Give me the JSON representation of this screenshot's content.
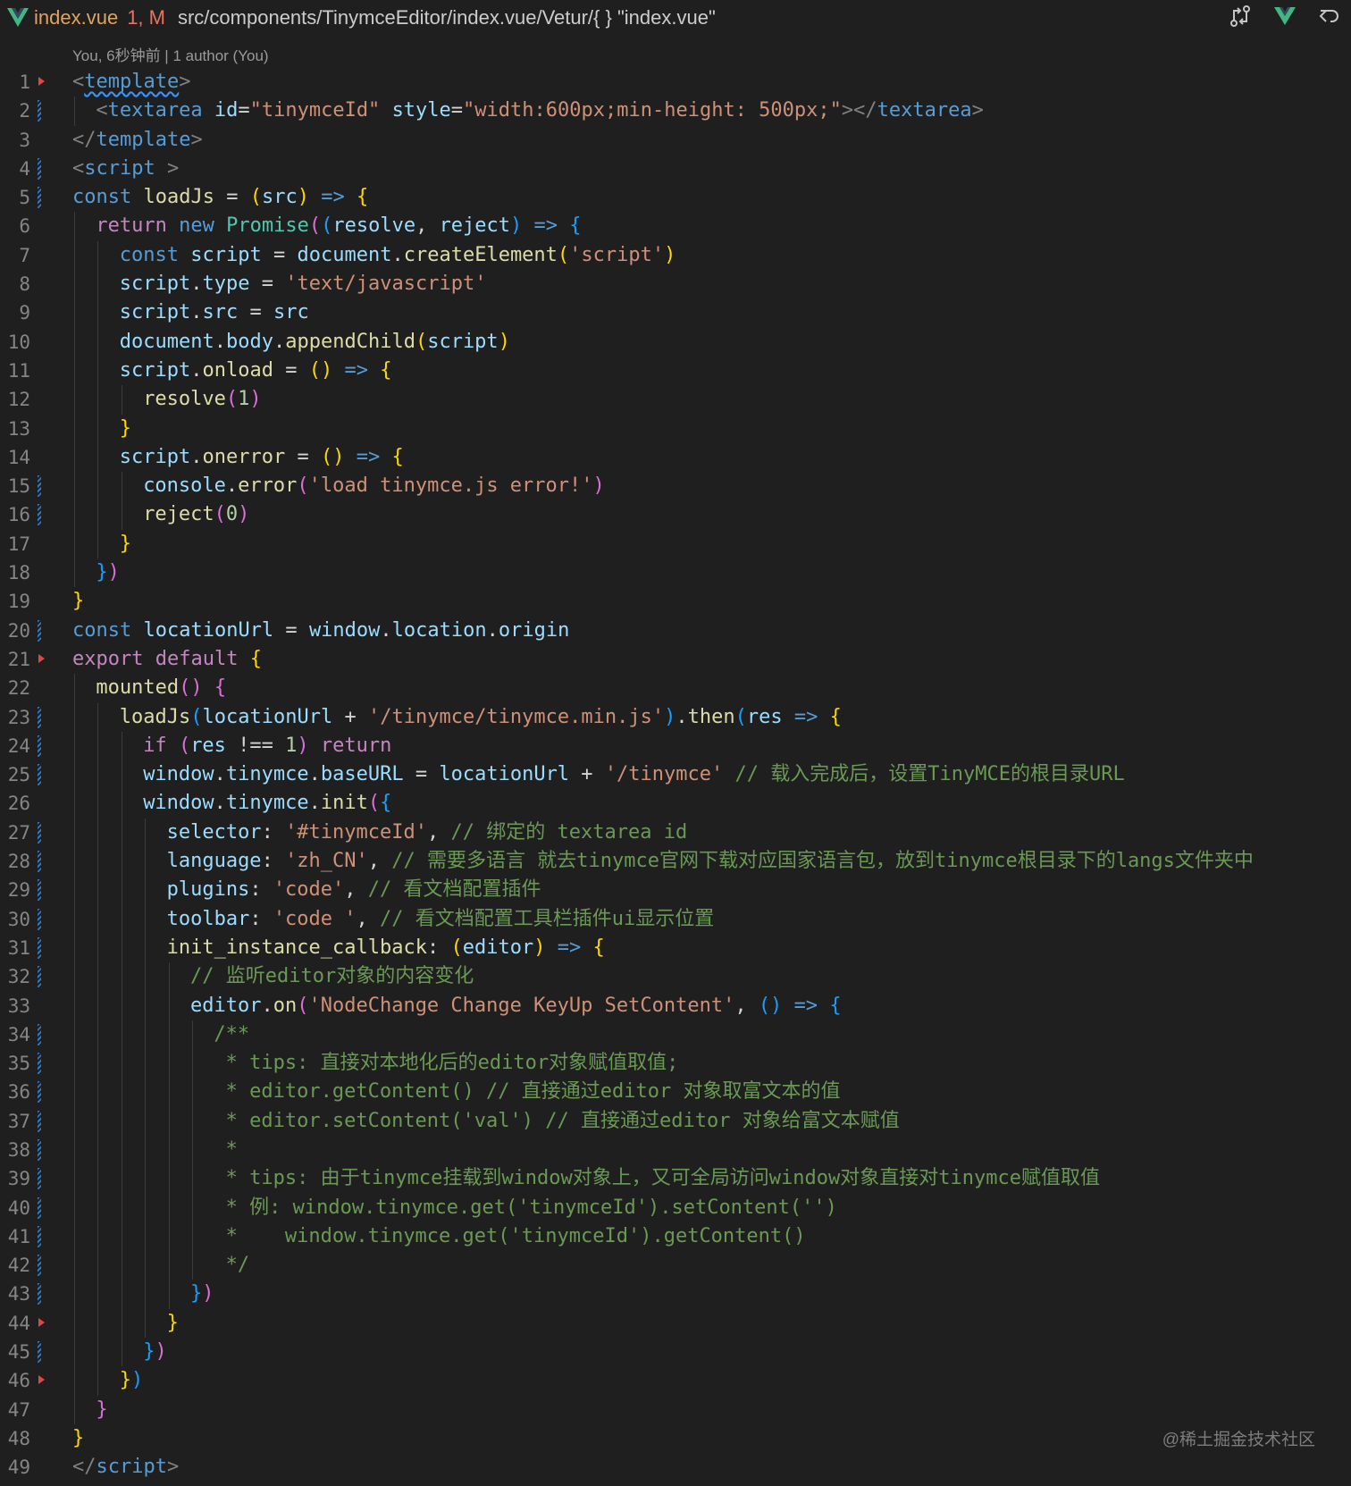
{
  "tab": {
    "name": "index.vue",
    "status": "1, M",
    "breadcrumb": "src/components/TinymceEditor/index.vue/Vetur/{ } \"index.vue\""
  },
  "blame": "You, 6秒钟前 | 1 author (You)",
  "lines": [
    {
      "n": "1",
      "gutter": "mark",
      "indent": 0,
      "tokens": [
        [
          "t-punc",
          "<"
        ],
        [
          "t-tag squiggle",
          "template"
        ],
        [
          "t-punc",
          ">"
        ]
      ]
    },
    {
      "n": "2",
      "gutter": "mod",
      "indent": 1,
      "tokens": [
        [
          "t-punc",
          "<"
        ],
        [
          "t-tag",
          "textarea"
        ],
        [
          "t-plain",
          " "
        ],
        [
          "t-attr",
          "id"
        ],
        [
          "t-plain",
          "="
        ],
        [
          "t-str",
          "\"tinymceId\""
        ],
        [
          "t-plain",
          " "
        ],
        [
          "t-attr",
          "style"
        ],
        [
          "t-plain",
          "="
        ],
        [
          "t-str",
          "\"width:600px;min-height: 500px;\""
        ],
        [
          "t-punc",
          "></"
        ],
        [
          "t-tag",
          "textarea"
        ],
        [
          "t-punc",
          ">"
        ]
      ]
    },
    {
      "n": "3",
      "gutter": "",
      "indent": 0,
      "tokens": [
        [
          "t-punc",
          "</"
        ],
        [
          "t-tag",
          "template"
        ],
        [
          "t-punc",
          ">"
        ]
      ]
    },
    {
      "n": "4",
      "gutter": "mod",
      "indent": 0,
      "tokens": [
        [
          "t-punc",
          "<"
        ],
        [
          "t-tag",
          "script"
        ],
        [
          "t-plain",
          " "
        ],
        [
          "t-punc",
          ">"
        ]
      ]
    },
    {
      "n": "5",
      "gutter": "mod",
      "indent": 0,
      "tokens": [
        [
          "t-kw",
          "const"
        ],
        [
          "t-plain",
          " "
        ],
        [
          "t-fn",
          "loadJs"
        ],
        [
          "t-plain",
          " = "
        ],
        [
          "t-b1",
          "("
        ],
        [
          "t-var",
          "src"
        ],
        [
          "t-b1",
          ")"
        ],
        [
          "t-plain",
          " "
        ],
        [
          "t-kw",
          "=>"
        ],
        [
          "t-plain",
          " "
        ],
        [
          "t-b1",
          "{"
        ]
      ]
    },
    {
      "n": "6",
      "gutter": "",
      "indent": 1,
      "tokens": [
        [
          "t-ctrl",
          "return"
        ],
        [
          "t-plain",
          " "
        ],
        [
          "t-kw",
          "new"
        ],
        [
          "t-plain",
          " "
        ],
        [
          "t-cls",
          "Promise"
        ],
        [
          "t-b2",
          "("
        ],
        [
          "t-b3",
          "("
        ],
        [
          "t-var",
          "resolve"
        ],
        [
          "t-plain",
          ", "
        ],
        [
          "t-var",
          "reject"
        ],
        [
          "t-b3",
          ")"
        ],
        [
          "t-plain",
          " "
        ],
        [
          "t-kw",
          "=>"
        ],
        [
          "t-plain",
          " "
        ],
        [
          "t-b3",
          "{"
        ]
      ]
    },
    {
      "n": "7",
      "gutter": "",
      "indent": 2,
      "tokens": [
        [
          "t-kw",
          "const"
        ],
        [
          "t-plain",
          " "
        ],
        [
          "t-var",
          "script"
        ],
        [
          "t-plain",
          " = "
        ],
        [
          "t-var",
          "document"
        ],
        [
          "t-plain",
          "."
        ],
        [
          "t-fn",
          "createElement"
        ],
        [
          "t-b1",
          "("
        ],
        [
          "t-str",
          "'script'"
        ],
        [
          "t-b1",
          ")"
        ]
      ]
    },
    {
      "n": "8",
      "gutter": "",
      "indent": 2,
      "tokens": [
        [
          "t-var",
          "script"
        ],
        [
          "t-plain",
          "."
        ],
        [
          "t-var",
          "type"
        ],
        [
          "t-plain",
          " = "
        ],
        [
          "t-str",
          "'text/javascript'"
        ]
      ]
    },
    {
      "n": "9",
      "gutter": "",
      "indent": 2,
      "tokens": [
        [
          "t-var",
          "script"
        ],
        [
          "t-plain",
          "."
        ],
        [
          "t-var",
          "src"
        ],
        [
          "t-plain",
          " = "
        ],
        [
          "t-var",
          "src"
        ]
      ]
    },
    {
      "n": "10",
      "gutter": "",
      "indent": 2,
      "tokens": [
        [
          "t-var",
          "document"
        ],
        [
          "t-plain",
          "."
        ],
        [
          "t-var",
          "body"
        ],
        [
          "t-plain",
          "."
        ],
        [
          "t-fn",
          "appendChild"
        ],
        [
          "t-b1",
          "("
        ],
        [
          "t-var",
          "script"
        ],
        [
          "t-b1",
          ")"
        ]
      ]
    },
    {
      "n": "11",
      "gutter": "",
      "indent": 2,
      "tokens": [
        [
          "t-var",
          "script"
        ],
        [
          "t-plain",
          "."
        ],
        [
          "t-fn",
          "onload"
        ],
        [
          "t-plain",
          " = "
        ],
        [
          "t-b1",
          "()"
        ],
        [
          "t-plain",
          " "
        ],
        [
          "t-kw",
          "=>"
        ],
        [
          "t-plain",
          " "
        ],
        [
          "t-b1",
          "{"
        ]
      ]
    },
    {
      "n": "12",
      "gutter": "",
      "indent": 3,
      "tokens": [
        [
          "t-fn",
          "resolve"
        ],
        [
          "t-b2",
          "("
        ],
        [
          "t-num",
          "1"
        ],
        [
          "t-b2",
          ")"
        ]
      ]
    },
    {
      "n": "13",
      "gutter": "",
      "indent": 2,
      "tokens": [
        [
          "t-b1",
          "}"
        ]
      ]
    },
    {
      "n": "14",
      "gutter": "",
      "indent": 2,
      "tokens": [
        [
          "t-var",
          "script"
        ],
        [
          "t-plain",
          "."
        ],
        [
          "t-fn",
          "onerror"
        ],
        [
          "t-plain",
          " = "
        ],
        [
          "t-b1",
          "()"
        ],
        [
          "t-plain",
          " "
        ],
        [
          "t-kw",
          "=>"
        ],
        [
          "t-plain",
          " "
        ],
        [
          "t-b1",
          "{"
        ]
      ]
    },
    {
      "n": "15",
      "gutter": "mod",
      "indent": 3,
      "tokens": [
        [
          "t-var",
          "console"
        ],
        [
          "t-plain",
          "."
        ],
        [
          "t-fn",
          "error"
        ],
        [
          "t-b2",
          "("
        ],
        [
          "t-str",
          "'load tinymce.js error!'"
        ],
        [
          "t-b2",
          ")"
        ]
      ]
    },
    {
      "n": "16",
      "gutter": "mod",
      "indent": 3,
      "tokens": [
        [
          "t-fn",
          "reject"
        ],
        [
          "t-b2",
          "("
        ],
        [
          "t-num",
          "0"
        ],
        [
          "t-b2",
          ")"
        ]
      ]
    },
    {
      "n": "17",
      "gutter": "",
      "indent": 2,
      "tokens": [
        [
          "t-b1",
          "}"
        ]
      ]
    },
    {
      "n": "18",
      "gutter": "",
      "indent": 1,
      "tokens": [
        [
          "t-b3",
          "}"
        ],
        [
          "t-b2",
          ")"
        ]
      ]
    },
    {
      "n": "19",
      "gutter": "",
      "indent": 0,
      "tokens": [
        [
          "t-b1",
          "}"
        ]
      ]
    },
    {
      "n": "20",
      "gutter": "mod",
      "indent": 0,
      "tokens": [
        [
          "t-kw",
          "const"
        ],
        [
          "t-plain",
          " "
        ],
        [
          "t-var",
          "locationUrl"
        ],
        [
          "t-plain",
          " = "
        ],
        [
          "t-var",
          "window"
        ],
        [
          "t-plain",
          "."
        ],
        [
          "t-var",
          "location"
        ],
        [
          "t-plain",
          "."
        ],
        [
          "t-var",
          "origin"
        ]
      ]
    },
    {
      "n": "21",
      "gutter": "mark",
      "indent": 0,
      "tokens": [
        [
          "t-ctrl",
          "export"
        ],
        [
          "t-plain",
          " "
        ],
        [
          "t-ctrl",
          "default"
        ],
        [
          "t-plain",
          " "
        ],
        [
          "t-b1",
          "{"
        ]
      ]
    },
    {
      "n": "22",
      "gutter": "",
      "indent": 1,
      "tokens": [
        [
          "t-fn",
          "mounted"
        ],
        [
          "t-b2",
          "()"
        ],
        [
          "t-plain",
          " "
        ],
        [
          "t-b2",
          "{"
        ]
      ]
    },
    {
      "n": "23",
      "gutter": "mod",
      "indent": 2,
      "tokens": [
        [
          "t-fn",
          "loadJs"
        ],
        [
          "t-b3",
          "("
        ],
        [
          "t-var",
          "locationUrl"
        ],
        [
          "t-plain",
          " + "
        ],
        [
          "t-str",
          "'/tinymce/tinymce.min.js'"
        ],
        [
          "t-b3",
          ")"
        ],
        [
          "t-plain",
          "."
        ],
        [
          "t-fn",
          "then"
        ],
        [
          "t-b3",
          "("
        ],
        [
          "t-var",
          "res"
        ],
        [
          "t-plain",
          " "
        ],
        [
          "t-kw",
          "=>"
        ],
        [
          "t-plain",
          " "
        ],
        [
          "t-b1",
          "{"
        ]
      ]
    },
    {
      "n": "24",
      "gutter": "mod",
      "indent": 3,
      "tokens": [
        [
          "t-ctrl",
          "if"
        ],
        [
          "t-plain",
          " "
        ],
        [
          "t-b2",
          "("
        ],
        [
          "t-var",
          "res"
        ],
        [
          "t-plain",
          " !== "
        ],
        [
          "t-num",
          "1"
        ],
        [
          "t-b2",
          ")"
        ],
        [
          "t-plain",
          " "
        ],
        [
          "t-ctrl",
          "return"
        ]
      ]
    },
    {
      "n": "25",
      "gutter": "mod",
      "indent": 3,
      "tokens": [
        [
          "t-var",
          "window"
        ],
        [
          "t-plain",
          "."
        ],
        [
          "t-var",
          "tinymce"
        ],
        [
          "t-plain",
          "."
        ],
        [
          "t-var",
          "baseURL"
        ],
        [
          "t-plain",
          " = "
        ],
        [
          "t-var",
          "locationUrl"
        ],
        [
          "t-plain",
          " + "
        ],
        [
          "t-str",
          "'/tinymce'"
        ],
        [
          "t-plain",
          " "
        ],
        [
          "t-com",
          "// 载入完成后，设置TinyMCE的根目录URL"
        ]
      ]
    },
    {
      "n": "26",
      "gutter": "",
      "indent": 3,
      "tokens": [
        [
          "t-var",
          "window"
        ],
        [
          "t-plain",
          "."
        ],
        [
          "t-var",
          "tinymce"
        ],
        [
          "t-plain",
          "."
        ],
        [
          "t-fn",
          "init"
        ],
        [
          "t-b2",
          "("
        ],
        [
          "t-b3",
          "{"
        ]
      ]
    },
    {
      "n": "27",
      "gutter": "mod",
      "indent": 4,
      "tokens": [
        [
          "t-var",
          "selector"
        ],
        [
          "t-plain",
          ": "
        ],
        [
          "t-str",
          "'#tinymceId'"
        ],
        [
          "t-plain",
          ", "
        ],
        [
          "t-com",
          "// 绑定的 textarea id"
        ]
      ]
    },
    {
      "n": "28",
      "gutter": "mod",
      "indent": 4,
      "tokens": [
        [
          "t-var",
          "language"
        ],
        [
          "t-plain",
          ": "
        ],
        [
          "t-str",
          "'zh_CN'"
        ],
        [
          "t-plain",
          ", "
        ],
        [
          "t-com",
          "// 需要多语言 就去tinymce官网下载对应国家语言包，放到tinymce根目录下的langs文件夹中"
        ]
      ]
    },
    {
      "n": "29",
      "gutter": "mod",
      "indent": 4,
      "tokens": [
        [
          "t-var",
          "plugins"
        ],
        [
          "t-plain",
          ": "
        ],
        [
          "t-str",
          "'code'"
        ],
        [
          "t-plain",
          ", "
        ],
        [
          "t-com",
          "// 看文档配置插件"
        ]
      ]
    },
    {
      "n": "30",
      "gutter": "mod",
      "indent": 4,
      "tokens": [
        [
          "t-var",
          "toolbar"
        ],
        [
          "t-plain",
          ": "
        ],
        [
          "t-str",
          "'code '"
        ],
        [
          "t-plain",
          ", "
        ],
        [
          "t-com",
          "// 看文档配置工具栏插件ui显示位置"
        ]
      ]
    },
    {
      "n": "31",
      "gutter": "mod",
      "indent": 4,
      "tokens": [
        [
          "t-fn",
          "init_instance_callback"
        ],
        [
          "t-plain",
          ": "
        ],
        [
          "t-b1",
          "("
        ],
        [
          "t-var",
          "editor"
        ],
        [
          "t-b1",
          ")"
        ],
        [
          "t-plain",
          " "
        ],
        [
          "t-kw",
          "=>"
        ],
        [
          "t-plain",
          " "
        ],
        [
          "t-b1",
          "{"
        ]
      ]
    },
    {
      "n": "32",
      "gutter": "mod",
      "indent": 5,
      "tokens": [
        [
          "t-com",
          "// 监听editor对象的内容变化"
        ]
      ]
    },
    {
      "n": "33",
      "gutter": "",
      "indent": 5,
      "tokens": [
        [
          "t-var",
          "editor"
        ],
        [
          "t-plain",
          "."
        ],
        [
          "t-fn",
          "on"
        ],
        [
          "t-b2",
          "("
        ],
        [
          "t-str",
          "'NodeChange Change KeyUp SetContent'"
        ],
        [
          "t-plain",
          ", "
        ],
        [
          "t-b3",
          "()"
        ],
        [
          "t-plain",
          " "
        ],
        [
          "t-kw",
          "=>"
        ],
        [
          "t-plain",
          " "
        ],
        [
          "t-b3",
          "{"
        ]
      ]
    },
    {
      "n": "34",
      "gutter": "mod",
      "indent": 6,
      "tokens": [
        [
          "t-com",
          "/**"
        ]
      ]
    },
    {
      "n": "35",
      "gutter": "mod",
      "indent": 6,
      "tokens": [
        [
          "t-com",
          " * tips: 直接对本地化后的editor对象赋值取值;"
        ]
      ]
    },
    {
      "n": "36",
      "gutter": "mod",
      "indent": 6,
      "tokens": [
        [
          "t-com",
          " * editor.getContent() // 直接通过editor 对象取富文本的值"
        ]
      ]
    },
    {
      "n": "37",
      "gutter": "mod",
      "indent": 6,
      "tokens": [
        [
          "t-com",
          " * editor.setContent('val') // 直接通过editor 对象给富文本赋值"
        ]
      ]
    },
    {
      "n": "38",
      "gutter": "mod",
      "indent": 6,
      "tokens": [
        [
          "t-com",
          " *"
        ]
      ]
    },
    {
      "n": "39",
      "gutter": "mod",
      "indent": 6,
      "tokens": [
        [
          "t-com",
          " * tips: 由于tinymce挂载到window对象上，又可全局访问window对象直接对tinymce赋值取值"
        ]
      ]
    },
    {
      "n": "40",
      "gutter": "mod",
      "indent": 6,
      "tokens": [
        [
          "t-com",
          " * 例: window.tinymce.get('tinymceId').setContent('')"
        ]
      ]
    },
    {
      "n": "41",
      "gutter": "mod",
      "indent": 6,
      "tokens": [
        [
          "t-com",
          " *    window.tinymce.get('tinymceId').getContent()"
        ]
      ]
    },
    {
      "n": "42",
      "gutter": "mod",
      "indent": 6,
      "tokens": [
        [
          "t-com",
          " */"
        ]
      ]
    },
    {
      "n": "43",
      "gutter": "mod",
      "indent": 5,
      "tokens": [
        [
          "t-b3",
          "}"
        ],
        [
          "t-b2",
          ")"
        ]
      ]
    },
    {
      "n": "44",
      "gutter": "mark",
      "indent": 4,
      "tokens": [
        [
          "t-b1",
          "}"
        ]
      ]
    },
    {
      "n": "45",
      "gutter": "mod",
      "indent": 3,
      "tokens": [
        [
          "t-b3",
          "}"
        ],
        [
          "t-b2",
          ")"
        ]
      ]
    },
    {
      "n": "46",
      "gutter": "mark",
      "indent": 2,
      "tokens": [
        [
          "t-b1",
          "}"
        ],
        [
          "t-b3",
          ")"
        ]
      ]
    },
    {
      "n": "47",
      "gutter": "",
      "indent": 1,
      "tokens": [
        [
          "t-b2",
          "}"
        ]
      ]
    },
    {
      "n": "48",
      "gutter": "",
      "indent": 0,
      "tokens": [
        [
          "t-b1",
          "}"
        ]
      ]
    },
    {
      "n": "49",
      "gutter": "",
      "indent": 0,
      "tokens": [
        [
          "t-punc",
          "</"
        ],
        [
          "t-tag",
          "script"
        ],
        [
          "t-punc",
          ">"
        ]
      ]
    }
  ],
  "watermark": "@稀土掘金技术社区"
}
